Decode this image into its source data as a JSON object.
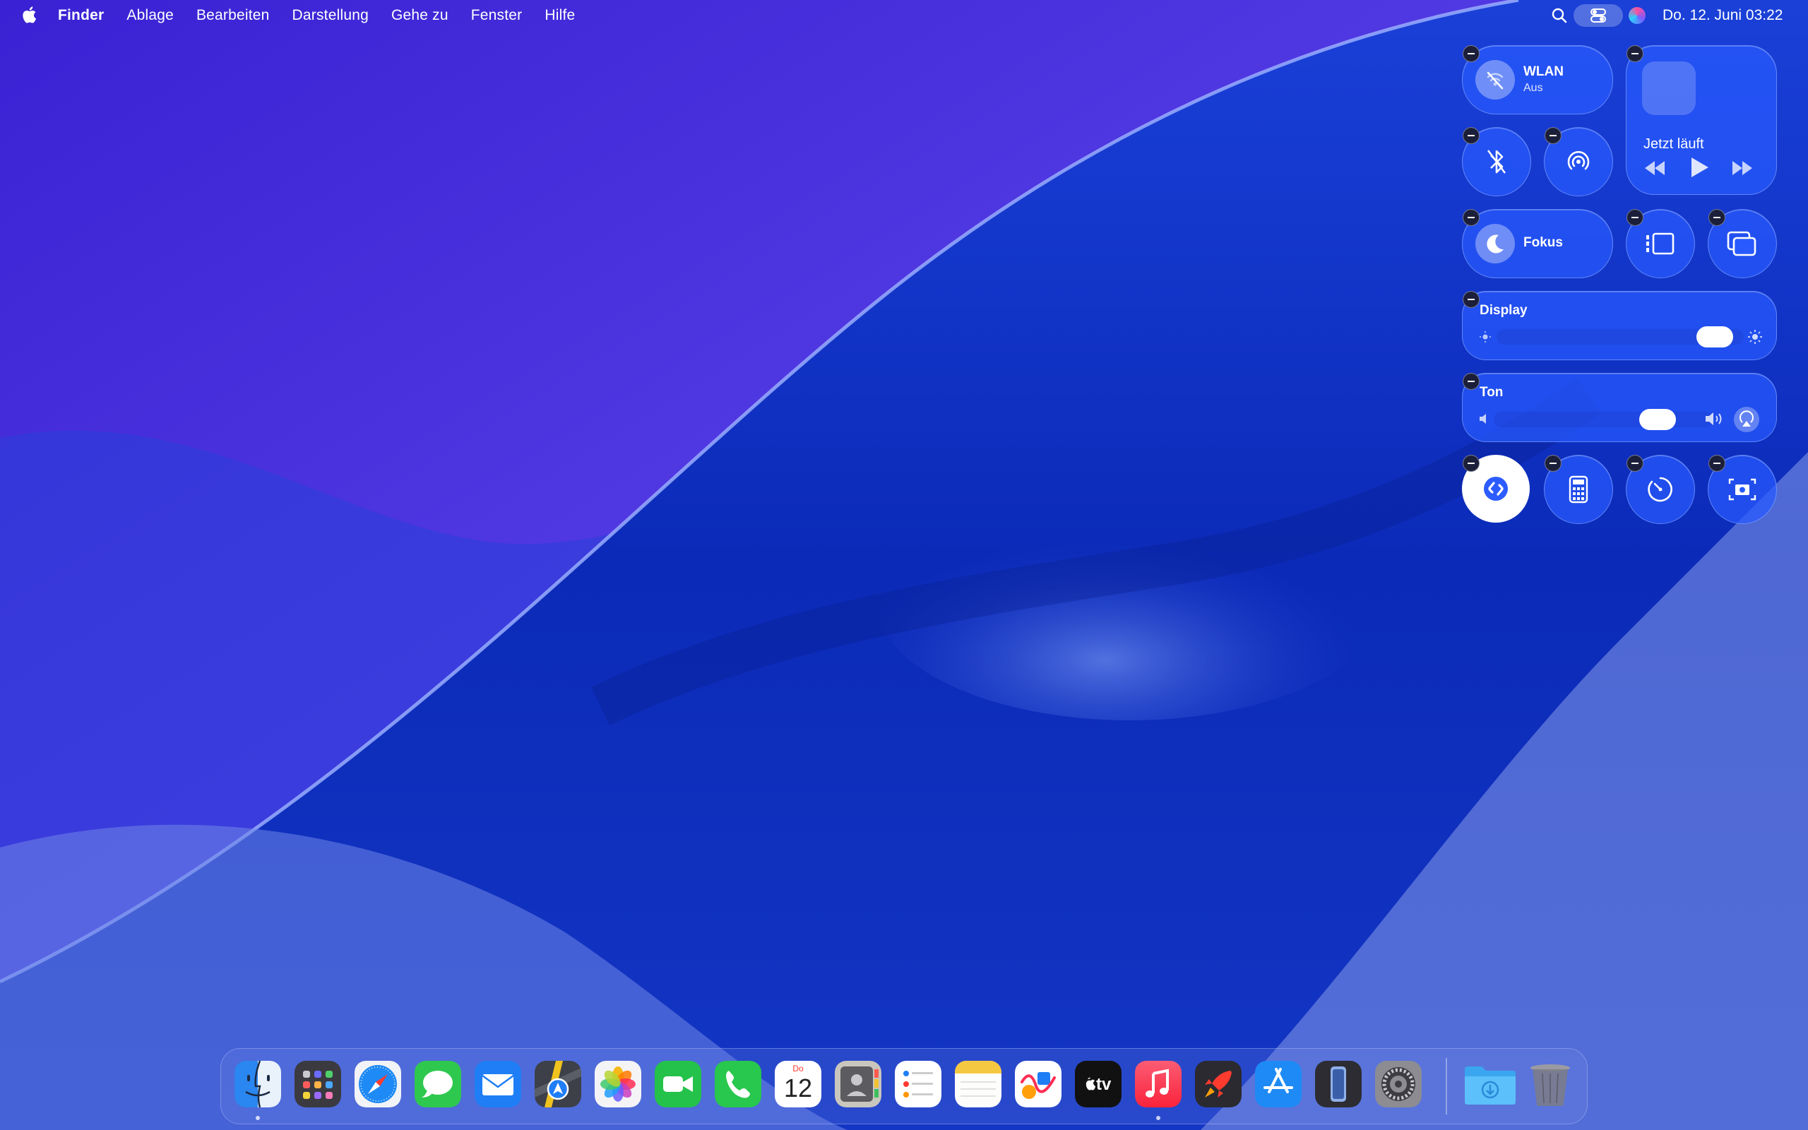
{
  "menubar": {
    "app_name": "Finder",
    "menus": [
      "Ablage",
      "Bearbeiten",
      "Darstellung",
      "Gehe zu",
      "Fenster",
      "Hilfe"
    ],
    "datetime": "Do. 12. Juni  03:22"
  },
  "control_center": {
    "wifi": {
      "title": "WLAN",
      "status": "Aus",
      "icon": "wifi-off-icon"
    },
    "bluetooth": {
      "icon": "bluetooth-off-icon"
    },
    "airdrop": {
      "icon": "airdrop-icon"
    },
    "now_playing": {
      "title": "Jetzt läuft"
    },
    "focus": {
      "title": "Fokus",
      "icon": "moon-icon"
    },
    "stage_manager": {
      "icon": "stage-manager-icon"
    },
    "screen_mirroring": {
      "icon": "screen-mirroring-icon"
    },
    "display": {
      "title": "Display",
      "brightness": 0.95
    },
    "sound": {
      "title": "Ton",
      "volume": 0.8
    },
    "bottom_row": [
      "shazam-icon",
      "calculator-icon",
      "timer-icon",
      "screenshot-icon"
    ]
  },
  "dock": {
    "calendar_month": "Do",
    "calendar_day": "12",
    "tv_label": "tv",
    "apps": [
      "Finder",
      "Launchpad",
      "Safari",
      "Nachrichten",
      "Mail",
      "Karten",
      "Fotos",
      "FaceTime",
      "Telefon",
      "Kalender",
      "Kontakte",
      "Erinnerungen",
      "Notizen",
      "Freeform",
      "TV",
      "Musik",
      "Rocket",
      "App Store",
      "iPhone-Synchronisierung",
      "Systemeinstellungen",
      "Downloads",
      "Papierkorb"
    ]
  },
  "colors": {
    "accent_blue": "#2c5cff",
    "tile_blue": "#285aff"
  }
}
